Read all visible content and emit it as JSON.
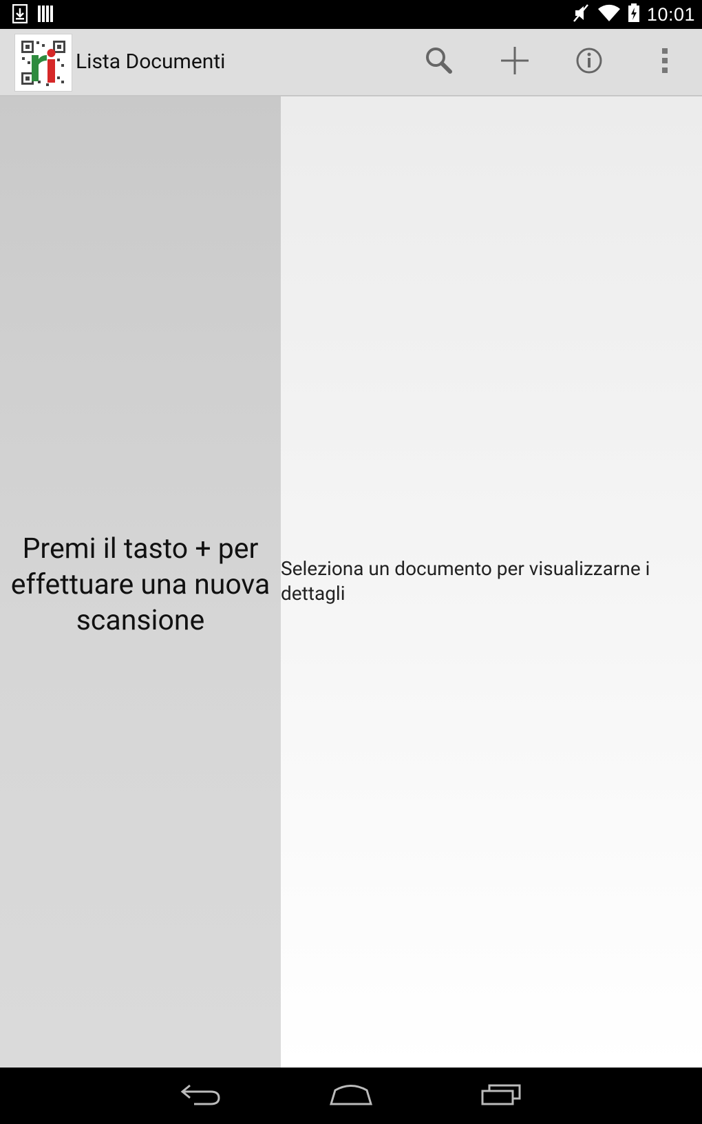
{
  "status_bar": {
    "time": "10:01",
    "icons": [
      "download-notification-icon",
      "storage-notification-icon",
      "mute-icon",
      "wifi-icon",
      "battery-charging-icon"
    ]
  },
  "action_bar": {
    "title": "Lista Documenti",
    "app_icon": "app-logo-icon",
    "actions": [
      "search-icon",
      "add-icon",
      "info-icon",
      "overflow-menu-icon"
    ]
  },
  "left_pane": {
    "message": "Premi il tasto + per effettuare una nuova scansione"
  },
  "right_pane": {
    "message": "Seleziona un documento per visualizzarne i dettagli"
  },
  "nav_bar": {
    "buttons": [
      "back-icon",
      "home-icon",
      "recent-apps-icon"
    ]
  }
}
